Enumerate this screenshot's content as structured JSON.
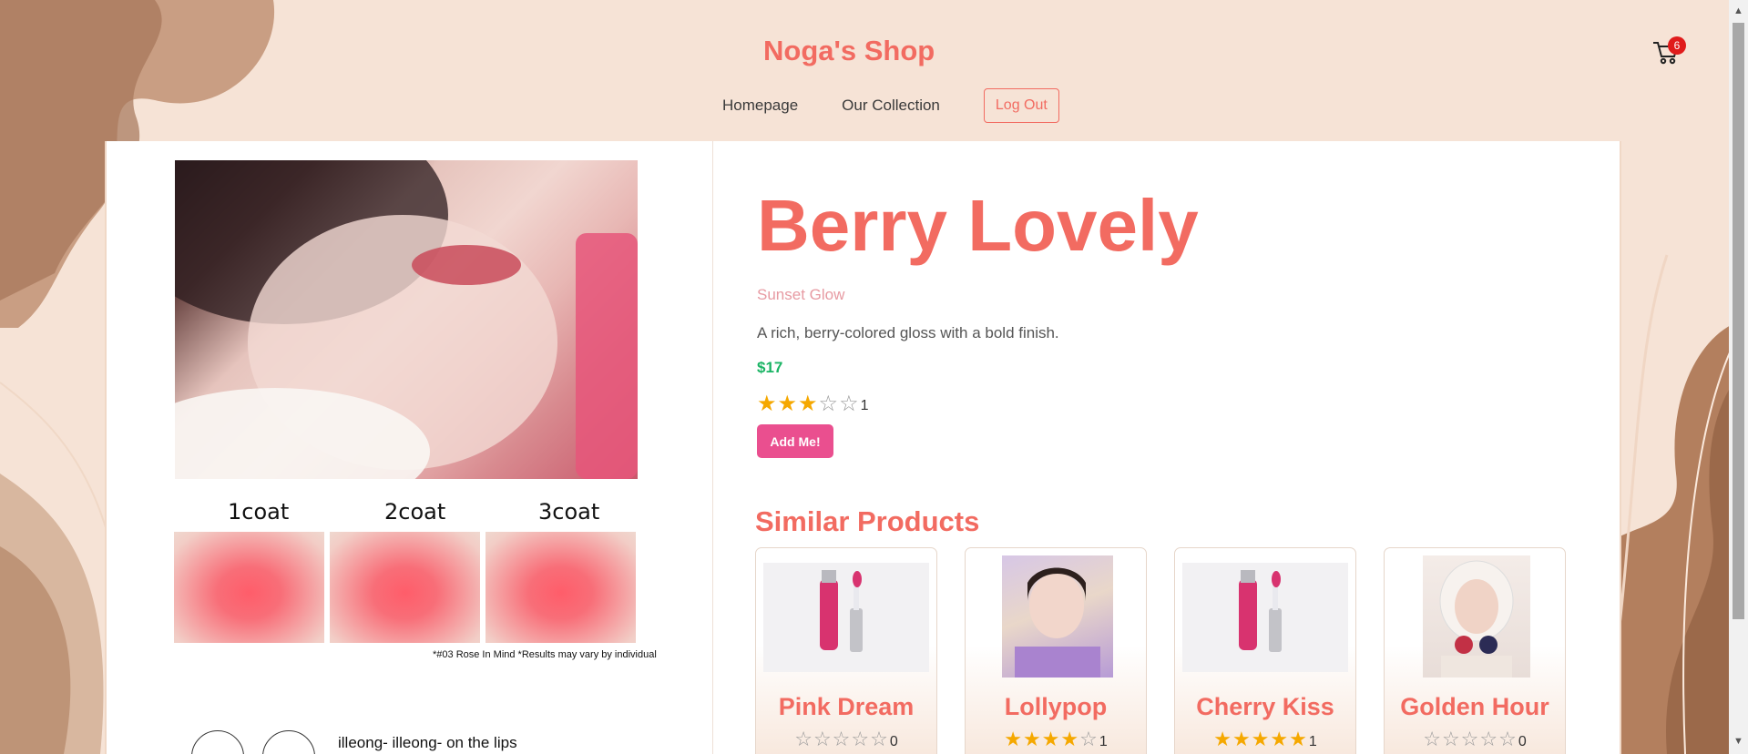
{
  "header": {
    "shop_title": "Noga's Shop",
    "nav": [
      "Homepage",
      "Our Collection"
    ],
    "logout_label": "Log Out",
    "cart_count": "6"
  },
  "gallery": {
    "coats": [
      "1coat",
      "2coat",
      "3coat"
    ],
    "note": "*#03 Rose In Mind *Results may vary by individual",
    "bottom_text": "illeong- illeong- on the lips"
  },
  "product": {
    "title": "Berry Lovely",
    "subtitle": "Sunset Glow",
    "description": "A rich, berry-colored gloss with a bold finish.",
    "price": "$17",
    "rating": 3,
    "rating_count": "1",
    "add_label": "Add Me!"
  },
  "similar": {
    "title": "Similar Products",
    "items": [
      {
        "name": "Pink Dream",
        "rating": 0,
        "count": "0"
      },
      {
        "name": "Lollypop",
        "rating": 4,
        "count": "1"
      },
      {
        "name": "Cherry Kiss",
        "rating": 5,
        "count": "1"
      },
      {
        "name": "Golden Hour",
        "rating": 0,
        "count": "0"
      }
    ]
  },
  "colors": {
    "accent": "#f26b61",
    "button": "#ea4f8f",
    "price": "#1ab464",
    "star": "#f5a800",
    "background": "#f6e3d6"
  },
  "icons": [
    "cart-icon",
    "star-icon"
  ]
}
